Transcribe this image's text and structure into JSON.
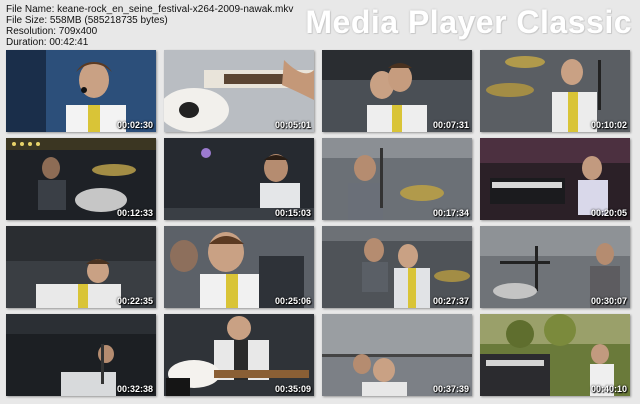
{
  "info": {
    "file_name": "File Name: keane-rock_en_seine_festival-x264-2009-nawak.mkv",
    "file_size": "File Size: 558MB (585218735 bytes)",
    "resolution": "Resolution: 709x400",
    "duration": "Duration: 00:42:41"
  },
  "brand": "Media Player Classic",
  "thumbnails": [
    {
      "timestamp": "00:02:30",
      "scene": "singer-closeup-blue"
    },
    {
      "timestamp": "00:05:01",
      "scene": "guitar-closeup"
    },
    {
      "timestamp": "00:07:31",
      "scene": "singer-stage"
    },
    {
      "timestamp": "00:10:02",
      "scene": "singer-drummer"
    },
    {
      "timestamp": "00:12:33",
      "scene": "drummer-dark"
    },
    {
      "timestamp": "00:15:03",
      "scene": "singer-profile-dark"
    },
    {
      "timestamp": "00:17:34",
      "scene": "singer-mic-stand"
    },
    {
      "timestamp": "00:20:05",
      "scene": "keyboardist"
    },
    {
      "timestamp": "00:22:35",
      "scene": "singer-crouch"
    },
    {
      "timestamp": "00:25:06",
      "scene": "singer-closeup-crowd"
    },
    {
      "timestamp": "00:27:37",
      "scene": "band-stage"
    },
    {
      "timestamp": "00:30:07",
      "scene": "keyboardist-side"
    },
    {
      "timestamp": "00:32:38",
      "scene": "singer-wide-dark"
    },
    {
      "timestamp": "00:35:09",
      "scene": "guitarist-white-guitar"
    },
    {
      "timestamp": "00:37:39",
      "scene": "singer-rig"
    },
    {
      "timestamp": "00:40:10",
      "scene": "keyboard-trees"
    }
  ]
}
